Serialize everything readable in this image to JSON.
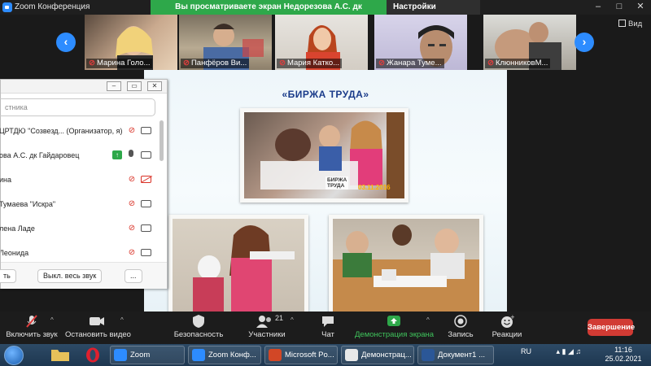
{
  "window": {
    "title": "Zoom Конференция"
  },
  "share_banner": "Вы просматриваете экран Недорезова А.С. дк Гайдаровец",
  "view_options": "Настройки просмотра ⌄",
  "grid_view_label": "Вид",
  "tiles": [
    {
      "name": "Марина Голо..."
    },
    {
      "name": "Панфёров Ви..."
    },
    {
      "name": "Мария Катко..."
    },
    {
      "name": "Жанара Туме..."
    },
    {
      "name": "КлюнниковМ..."
    }
  ],
  "slide": {
    "title": "«БИРЖА ТРУДА»",
    "photo_caption": "БИРЖА\nТРУДА",
    "photo_date": "03.11.2016"
  },
  "participants": {
    "search_placeholder": "стника",
    "rows": [
      {
        "name": "ЦРТДЮ \"Созвезд... (Организатор, я)"
      },
      {
        "name": "ова А.С. дк Гайдаровец"
      },
      {
        "name": "ина"
      },
      {
        "name": "Тумаева \"Искра\""
      },
      {
        "name": "лена Ладе"
      },
      {
        "name": "Леонида"
      }
    ],
    "footer": {
      "left_btn": "ть",
      "mute_all": "Выкл. весь звук",
      "more": "..."
    }
  },
  "toolbar": {
    "unmute": "Включить звук",
    "start_video": "Остановить видео",
    "security": "Безопасность",
    "participants": "Участники",
    "participants_count": "21",
    "chat": "Чат",
    "share": "Демонстрация экрана",
    "record": "Запись",
    "reactions": "Реакции",
    "end": "Завершение"
  },
  "taskbar": {
    "items": [
      {
        "label": "Zoom"
      },
      {
        "label": "Zoom Конф..."
      },
      {
        "label": "Microsoft Po..."
      },
      {
        "label": "Демонстрац..."
      },
      {
        "label": "Документ1 ..."
      }
    ],
    "lang": "RU",
    "time": "11:16",
    "date": "25.02.2021"
  },
  "colors": {
    "accent": "#2d8cff",
    "share_green": "#2ea84a",
    "end_red": "#d13b34"
  }
}
